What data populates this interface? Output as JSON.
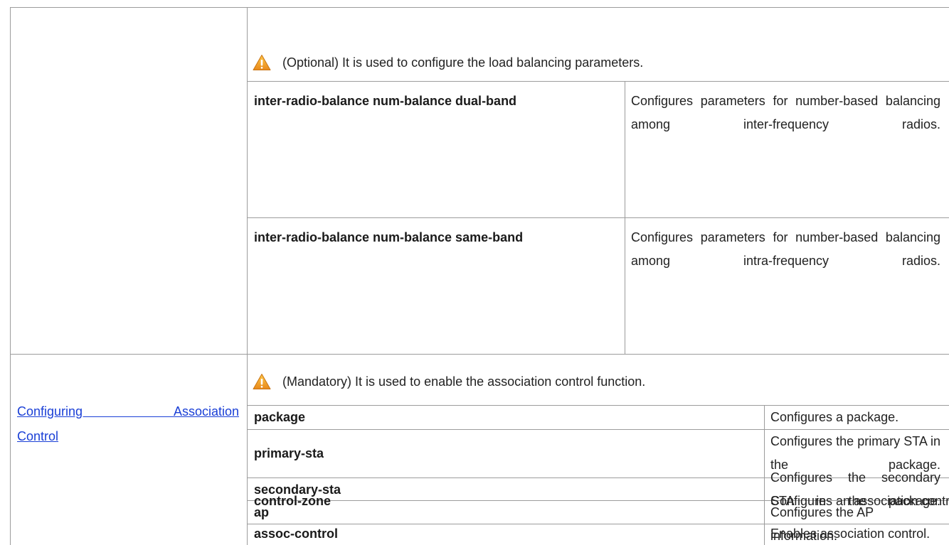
{
  "sections": [
    {
      "link": "",
      "notice": "(Optional) It is used to configure the load balancing parameters.",
      "rows": [
        {
          "command": "inter-radio-balance num-balance dual-band",
          "description": "Configures parameters for number-based balancing among inter-frequency radios."
        },
        {
          "command": "inter-radio-balance num-balance same-band",
          "description": "Configures parameters for number-based balancing among intra-frequency radios."
        }
      ]
    },
    {
      "link_line1": "Configuring Association",
      "link_line2": "Control",
      "notice": "(Mandatory) It is used to enable the association control function.",
      "rows": [
        {
          "command": "package",
          "description": "Configures a package."
        },
        {
          "command": "primary-sta",
          "description": "Configures the primary STA in the package."
        },
        {
          "command": "secondary-sta",
          "description": "Configures the secondary STA in the package."
        },
        {
          "command": "control-zone",
          "description": "Configures an association control zone."
        },
        {
          "command": "ap",
          "description": "Configures the AP information."
        },
        {
          "command": "assoc-control",
          "description": "Enables association control."
        }
      ]
    }
  ],
  "icons": {
    "notice_icon": "warning-triangle-icon",
    "warning_color": "#f0a21e"
  }
}
